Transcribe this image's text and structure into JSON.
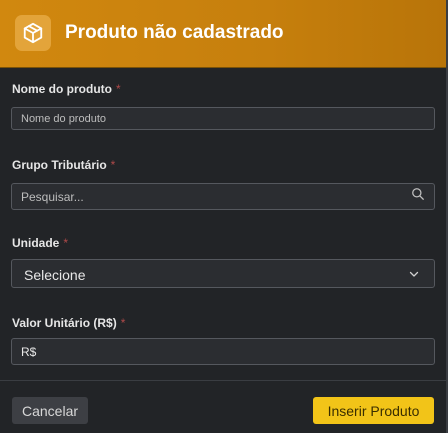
{
  "header": {
    "title": "Produto não cadastrado",
    "icon": "box-icon",
    "background": "#c9830e"
  },
  "fields": {
    "nome": {
      "label": "Nome do produto",
      "required_mark": "*",
      "value": "",
      "placeholder": "Nome do produto"
    },
    "grupo": {
      "label": "Grupo Tributário",
      "required_mark": "*",
      "value": "",
      "placeholder": "Pesquisar...",
      "icon": "search-icon"
    },
    "unidade": {
      "label": "Unidade",
      "required_mark": "*",
      "selected": "Selecione",
      "icon": "chevron-down-icon"
    },
    "valor": {
      "label": "Valor Unitário (R$)",
      "required_mark": "*",
      "value": "R$",
      "placeholder": ""
    }
  },
  "footer": {
    "cancel_label": "Cancelar",
    "submit_label": "Inserir Produto",
    "submit_color": "#f2c418"
  }
}
